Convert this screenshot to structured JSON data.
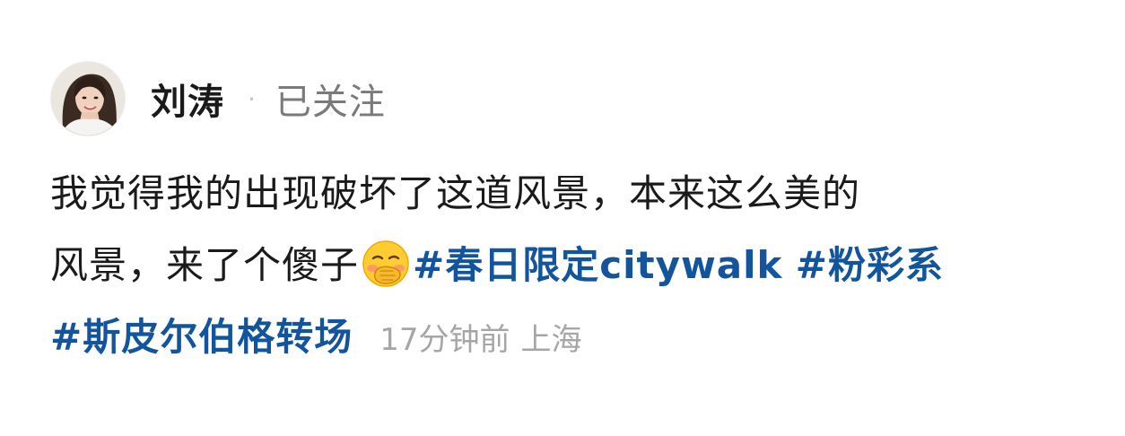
{
  "author": {
    "name": "刘涛",
    "separator": "·",
    "follow_status": "已关注"
  },
  "post": {
    "text_line1": "我觉得我的出现破坏了这道风景，本来这么美的",
    "text_line2_part1": "风景，来了个傻子",
    "emoji": "hand-over-mouth-emoji",
    "hashtags": [
      "#春日限定citywalk",
      "#粉彩系",
      "#斯皮尔伯格转场"
    ],
    "time_ago": "17分钟前",
    "location": "上海"
  },
  "colors": {
    "hashtag": "#13559c",
    "meta": "#a6a6a6",
    "text": "#1a1a1a"
  }
}
